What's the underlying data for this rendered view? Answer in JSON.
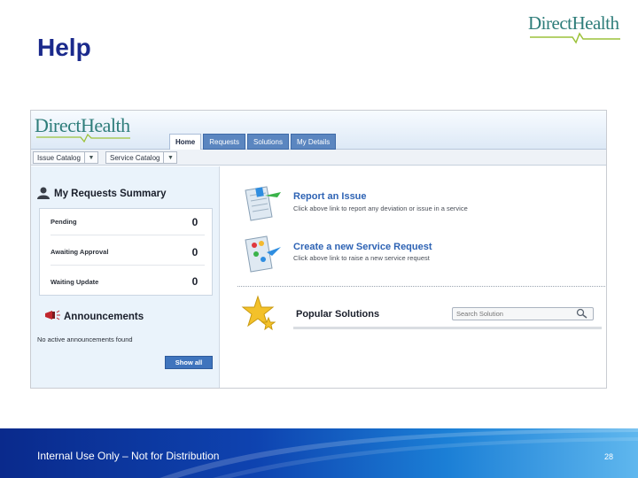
{
  "slide": {
    "title": "Help",
    "footer_text": "Internal Use Only – Not for Distribution",
    "page_number": "28"
  },
  "logo": {
    "direct": "Direct",
    "health": "Health"
  },
  "app": {
    "tabs": [
      {
        "label": "Home",
        "active": true
      },
      {
        "label": "Requests",
        "active": false
      },
      {
        "label": "Solutions",
        "active": false
      },
      {
        "label": "My Details",
        "active": false
      }
    ],
    "dropdowns": {
      "issue_catalog": "Issue Catalog",
      "service_catalog": "Service Catalog"
    },
    "summary": {
      "title": "My Requests Summary",
      "rows": [
        {
          "label": "Pending",
          "count": "0"
        },
        {
          "label": "Awaiting Approval",
          "count": "0"
        },
        {
          "label": "Waiting Update",
          "count": "0"
        }
      ]
    },
    "announcements": {
      "title": "Announcements",
      "empty_text": "No active announcements found",
      "show_all": "Show all"
    },
    "actions": {
      "report_issue": {
        "title": "Report an Issue",
        "desc": "Click above link to report any deviation or issue in a service"
      },
      "new_request": {
        "title": "Create a new Service Request",
        "desc": "Click above link to raise a new service request"
      }
    },
    "popular": {
      "title": "Popular Solutions",
      "search_placeholder": "Search Solution"
    }
  },
  "colors": {
    "title_blue": "#1b2a8c",
    "link_blue": "#2e63b4",
    "logo_teal": "#2e7d7a",
    "tab_blue": "#5b86c0"
  }
}
